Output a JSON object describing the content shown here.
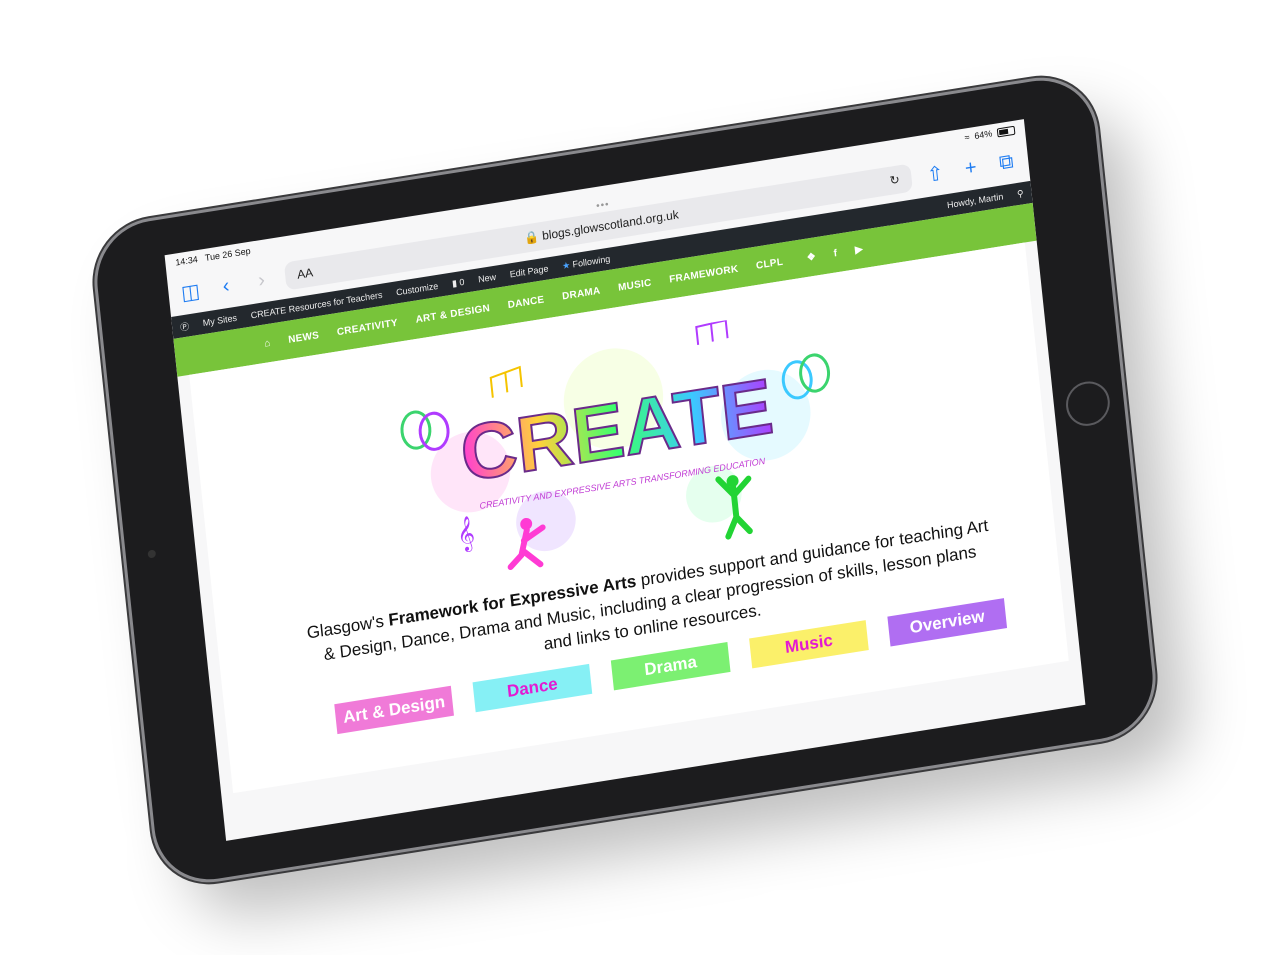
{
  "status": {
    "time": "14:34",
    "date": "Tue 26 Sep",
    "battery": "64%"
  },
  "browser": {
    "text_size": "AA",
    "url": "blogs.glowscotland.org.uk",
    "more_dots": "•••"
  },
  "admin_bar": {
    "my_sites": "My Sites",
    "site_name": "CREATE Resources for Teachers",
    "customize": "Customize",
    "comments": "0",
    "new": "New",
    "edit_page": "Edit Page",
    "following": "Following",
    "howdy": "Howdy, Martin"
  },
  "nav": {
    "items": [
      {
        "label": "NEWS"
      },
      {
        "label": "CREATIVITY"
      },
      {
        "label": "ART & DESIGN"
      },
      {
        "label": "DANCE"
      },
      {
        "label": "DRAMA"
      },
      {
        "label": "MUSIC"
      },
      {
        "label": "FRAMEWORK"
      },
      {
        "label": "CLPL"
      }
    ]
  },
  "logo": {
    "word": "CREATE",
    "tagline": "CREATIVITY AND EXPRESSIVE ARTS TRANSFORMING EDUCATION"
  },
  "intro": {
    "prefix": "Glasgow's",
    "bold": "Framework for Expressive Arts",
    "suffix": "provides support and guidance for teaching Art & Design, Dance, Drama and Music, including a clear progression of skills, lesson plans and links to online resources."
  },
  "buttons": [
    {
      "label": "Art & Design",
      "bg": "#f07ad8",
      "fg": "#ffffff"
    },
    {
      "label": "Dance",
      "bg": "#86f0f5",
      "fg": "#e31ad2"
    },
    {
      "label": "Drama",
      "bg": "#7cf072",
      "fg": "#ffffff"
    },
    {
      "label": "Music",
      "bg": "#fbf06a",
      "fg": "#e31ad2"
    },
    {
      "label": "Overview",
      "bg": "#b06ef2",
      "fg": "#ffffff"
    }
  ],
  "colors": {
    "nav_green": "#78c43a",
    "admin_dark": "#23282d",
    "ios_blue": "#1e7cf2"
  }
}
